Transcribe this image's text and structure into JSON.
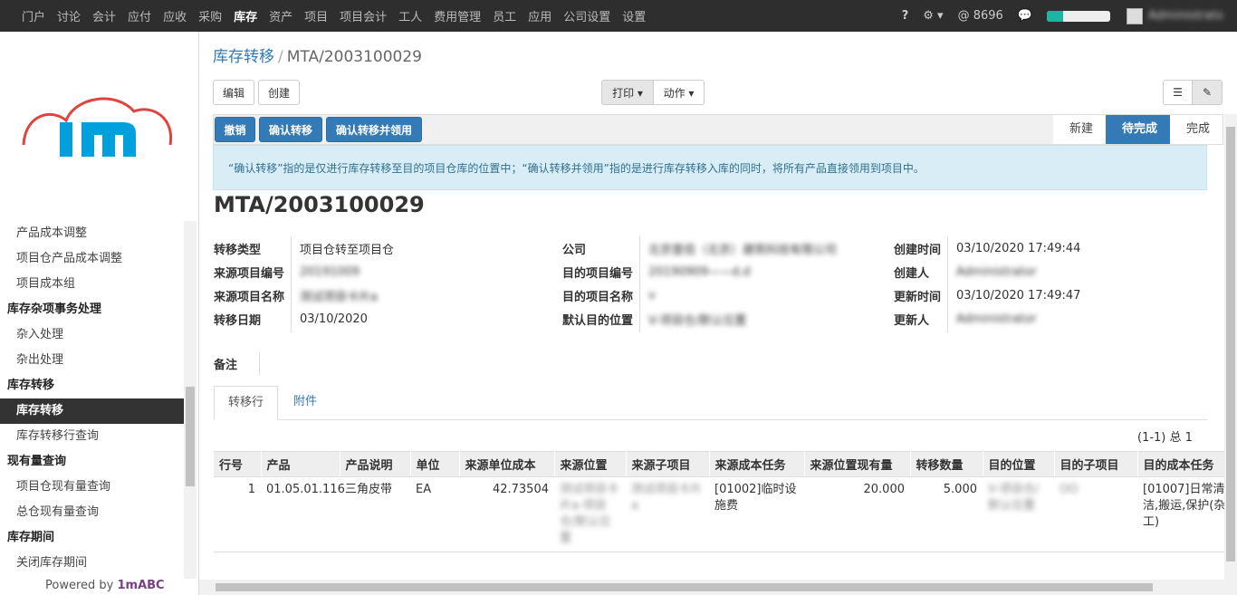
{
  "topnav": {
    "menus": [
      "门户",
      "讨论",
      "会计",
      "应付",
      "应收",
      "采购",
      "库存",
      "资产",
      "项目",
      "项目会计",
      "工人",
      "费用管理",
      "员工",
      "应用",
      "公司设置",
      "设置"
    ],
    "active_index": 6,
    "help": "?",
    "settings": "⚙",
    "at_count": "@ 8696",
    "progress_fraction": 0.25,
    "user": "Administrator"
  },
  "sidebar": {
    "logo_text": "1m",
    "items": [
      {
        "label": "产品成本调整",
        "type": "link"
      },
      {
        "label": "项目仓产品成本调整",
        "type": "link"
      },
      {
        "label": "项目成本组",
        "type": "link"
      },
      {
        "label": "库存杂项事务处理",
        "type": "group"
      },
      {
        "label": "杂入处理",
        "type": "link"
      },
      {
        "label": "杂出处理",
        "type": "link"
      },
      {
        "label": "库存转移",
        "type": "group"
      },
      {
        "label": "库存转移",
        "type": "active"
      },
      {
        "label": "库存转移行查询",
        "type": "link"
      },
      {
        "label": "现有量查询",
        "type": "group"
      },
      {
        "label": "项目仓现有量查询",
        "type": "link"
      },
      {
        "label": "总仓现有量查询",
        "type": "link"
      },
      {
        "label": "库存期间",
        "type": "group"
      },
      {
        "label": "关闭库存期间",
        "type": "link"
      }
    ],
    "powered_prefix": "Powered by ",
    "powered_brand": "1mABC"
  },
  "breadcrumb": {
    "parent": "库存转移",
    "separator": "/",
    "current": "MTA/2003100029"
  },
  "toolbar": {
    "edit": "编辑",
    "create": "创建",
    "print": "打印 ▾",
    "action": "动作 ▾",
    "list_icon": "☰",
    "form_icon": "✎"
  },
  "actions": {
    "cancel": "撤销",
    "confirm": "确认转移",
    "confirm_use": "确认转移并领用"
  },
  "stages": [
    "新建",
    "待完成",
    "完成"
  ],
  "stage_current": 1,
  "alert": "“确认转移”指的是仅进行库存转移至目的项目仓库的位置中；“确认转移并领用”指的是进行库存转移入库的同时，将所有产品直接领用到项目中。",
  "record": {
    "title": "MTA/2003100029",
    "col1": [
      {
        "label": "转移类型",
        "value": "项目仓转至项目仓",
        "blur": false
      },
      {
        "label": "来源项目编号",
        "value": "20191009",
        "blur": true
      },
      {
        "label": "来源项目名称",
        "value": "测试项目卡片a",
        "blur": true
      },
      {
        "label": "转移日期",
        "value": "03/10/2020",
        "blur": false
      }
    ],
    "col2": [
      {
        "label": "公司",
        "value": "北京壹佰（北京）建筑科技有限公司",
        "blur": true
      },
      {
        "label": "目的项目编号",
        "value": "20190909——d.d",
        "blur": true
      },
      {
        "label": "目的项目名称",
        "value": "v",
        "blur": true
      },
      {
        "label": "默认目的位置",
        "value": "V-项目仓/默认位置",
        "blur": true
      }
    ],
    "col3": [
      {
        "label": "创建时间",
        "value": "03/10/2020 17:49:44",
        "blur": false
      },
      {
        "label": "创建人",
        "value": "Administrator",
        "blur": true
      },
      {
        "label": "更新时间",
        "value": "03/10/2020 17:49:47",
        "blur": false
      },
      {
        "label": "更新人",
        "value": "Administrator",
        "blur": true
      }
    ],
    "note_label": "备注"
  },
  "tabs": [
    "转移行",
    "附件"
  ],
  "pager": "(1-1) 总 1",
  "lines": {
    "columns": [
      "行号",
      "产品",
      "产品说明",
      "单位",
      "来源单位成本",
      "来源位置",
      "来源子项目",
      "来源成本任务",
      "来源位置现有量",
      "转移数量",
      "目的位置",
      "目的子项目",
      "目的成本任务"
    ],
    "rows": [
      {
        "no": "1",
        "product": "01.05.01.116",
        "desc": "三角皮带",
        "unit": "EA",
        "unit_cost": "42.73504",
        "src_loc": "测试项目卡片a-项目仓/默认位置",
        "src_sub": "测试项目卡片a",
        "src_task": "[01002]临时设施费",
        "onhand": "20.000",
        "qty": "5.000",
        "dst_loc": "V-项目仓/默认位置",
        "dst_sub": "OO",
        "dst_task": "[01007]日常清洁,搬运,保护(杂工)"
      }
    ]
  }
}
